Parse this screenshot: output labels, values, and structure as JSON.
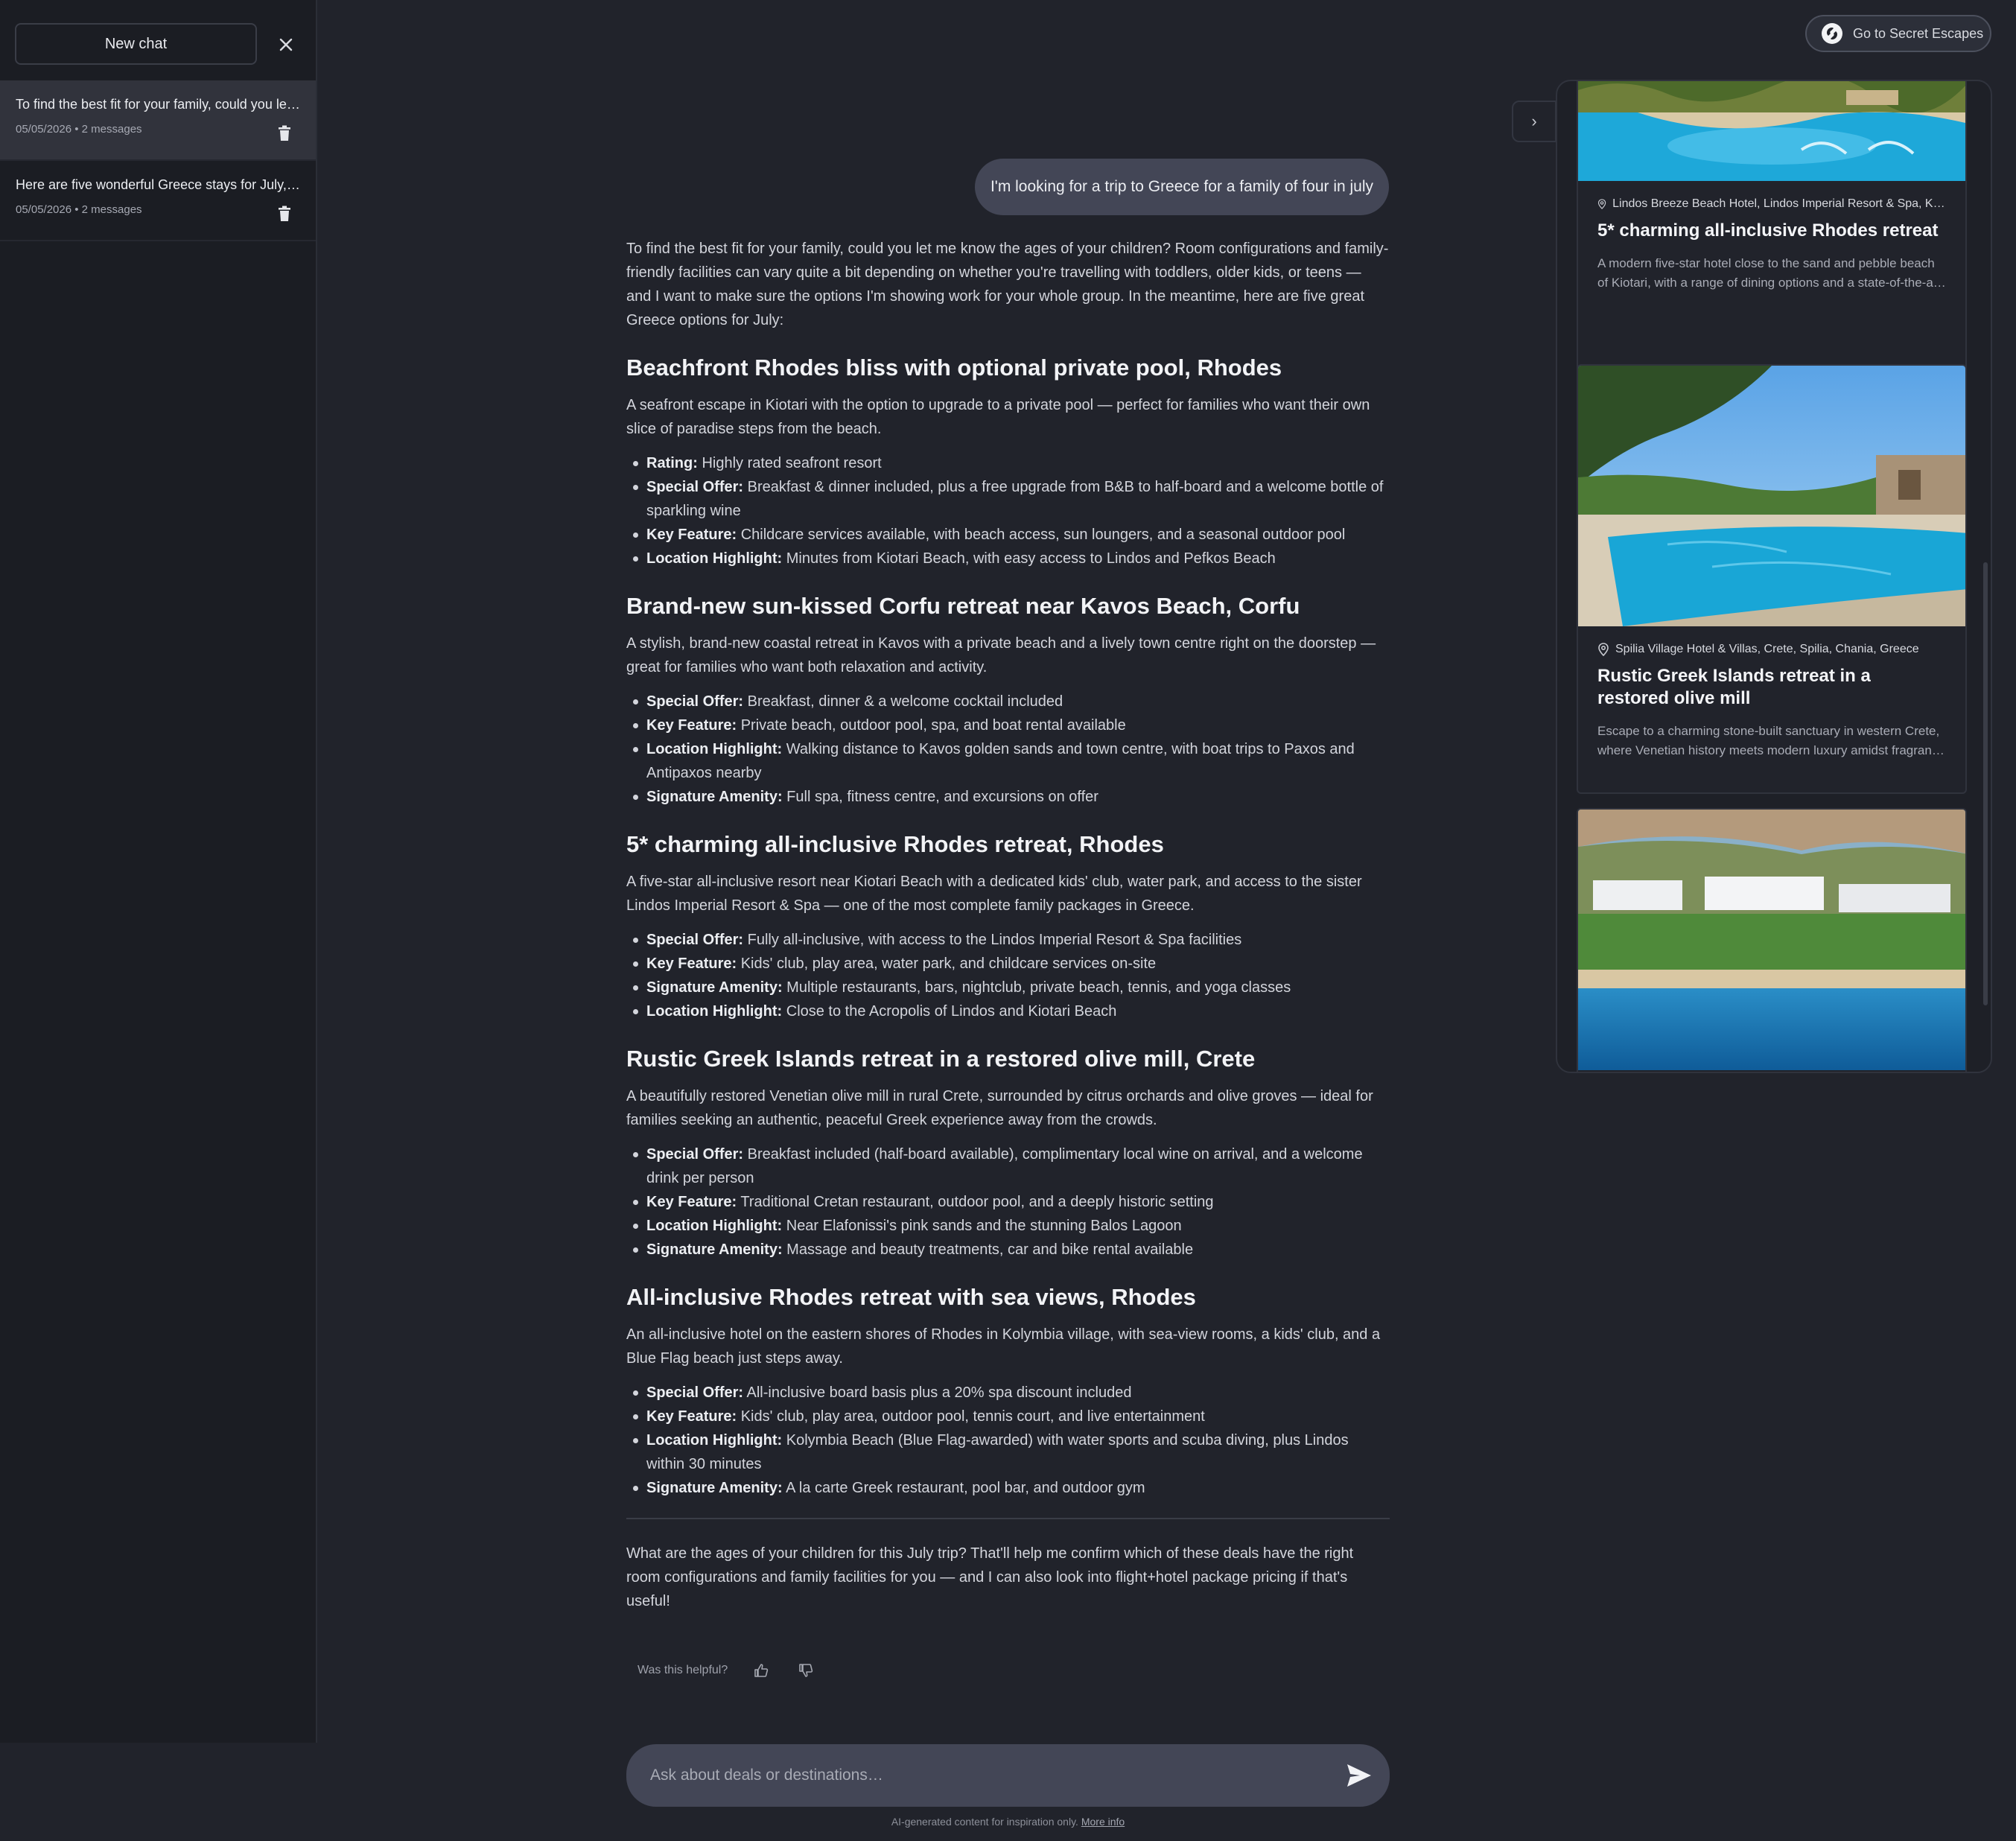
{
  "sidebar": {
    "new_chat_label": "New chat",
    "history": [
      {
        "title": "To find the best fit for your family, could you let me know the ages of your children?",
        "meta": "05/05/2026 • 2 messages"
      },
      {
        "title": "Here are five wonderful Greece stays for July, ready to book",
        "meta": "05/05/2026 • 2 messages"
      }
    ]
  },
  "header": {
    "goto_label": "Go to Secret Escapes"
  },
  "chat": {
    "user_message": "I'm looking for a trip to Greece for a family of four in july",
    "intro": "To find the best fit for your family, could you let me know the ages of your children? Room configurations and family-friendly facilities can vary quite a bit depending on whether you're travelling with toddlers, older kids, or teens — and I want to make sure the options I'm showing work for your whole group. In the meantime, here are five great Greece options for July:",
    "sections": [
      {
        "heading": "Beachfront Rhodes bliss with optional private pool, Rhodes",
        "desc": "A seafront escape in Kiotari with the option to upgrade to a private pool — perfect for families who want their own slice of paradise steps from the beach.",
        "bullets": [
          {
            "label": "Rating:",
            "text": " Highly rated seafront resort"
          },
          {
            "label": "Special Offer:",
            "text": " Breakfast & dinner included, plus a free upgrade from B&B to half-board and a welcome bottle of sparkling wine"
          },
          {
            "label": "Key Feature:",
            "text": " Childcare services available, with beach access, sun loungers, and a seasonal outdoor pool"
          },
          {
            "label": "Location Highlight:",
            "text": " Minutes from Kiotari Beach, with easy access to Lindos and Pefkos Beach"
          }
        ]
      },
      {
        "heading": "Brand-new sun-kissed Corfu retreat near Kavos Beach, Corfu",
        "desc": "A stylish, brand-new coastal retreat in Kavos with a private beach and a lively town centre right on the doorstep — great for families who want both relaxation and activity.",
        "bullets": [
          {
            "label": "Special Offer:",
            "text": " Breakfast, dinner & a welcome cocktail included"
          },
          {
            "label": "Key Feature:",
            "text": " Private beach, outdoor pool, spa, and boat rental available"
          },
          {
            "label": "Location Highlight:",
            "text": " Walking distance to Kavos golden sands and town centre, with boat trips to Paxos and Antipaxos nearby"
          },
          {
            "label": "Signature Amenity:",
            "text": " Full spa, fitness centre, and excursions on offer"
          }
        ]
      },
      {
        "heading": "5* charming all-inclusive Rhodes retreat, Rhodes",
        "desc": "A five-star all-inclusive resort near Kiotari Beach with a dedicated kids' club, water park, and access to the sister Lindos Imperial Resort & Spa — one of the most complete family packages in Greece.",
        "bullets": [
          {
            "label": "Special Offer:",
            "text": " Fully all-inclusive, with access to the Lindos Imperial Resort & Spa facilities"
          },
          {
            "label": "Key Feature:",
            "text": " Kids' club, play area, water park, and childcare services on-site"
          },
          {
            "label": "Signature Amenity:",
            "text": " Multiple restaurants, bars, nightclub, private beach, tennis, and yoga classes"
          },
          {
            "label": "Location Highlight:",
            "text": " Close to the Acropolis of Lindos and Kiotari Beach"
          }
        ]
      },
      {
        "heading": "Rustic Greek Islands retreat in a restored olive mill, Crete",
        "desc": "A beautifully restored Venetian olive mill in rural Crete, surrounded by citrus orchards and olive groves — ideal for families seeking an authentic, peaceful Greek experience away from the crowds.",
        "bullets": [
          {
            "label": "Special Offer:",
            "text": " Breakfast included (half-board available), complimentary local wine on arrival, and a welcome drink per person"
          },
          {
            "label": "Key Feature:",
            "text": " Traditional Cretan restaurant, outdoor pool, and a deeply historic setting"
          },
          {
            "label": "Location Highlight:",
            "text": " Near Elafonissi's pink sands and the stunning Balos Lagoon"
          },
          {
            "label": "Signature Amenity:",
            "text": " Massage and beauty treatments, car and bike rental available"
          }
        ]
      },
      {
        "heading": "All-inclusive Rhodes retreat with sea views, Rhodes",
        "desc": "An all-inclusive hotel on the eastern shores of Rhodes in Kolymbia village, with sea-view rooms, a kids' club, and a Blue Flag beach just steps away.",
        "bullets": [
          {
            "label": "Special Offer:",
            "text": " All-inclusive board basis plus a 20% spa discount included"
          },
          {
            "label": "Key Feature:",
            "text": " Kids' club, play area, outdoor pool, tennis court, and live entertainment"
          },
          {
            "label": "Location Highlight:",
            "text": " Kolymbia Beach (Blue Flag-awarded) with water sports and scuba diving, plus Lindos within 30 minutes"
          },
          {
            "label": "Signature Amenity:",
            "text": " A la carte Greek restaurant, pool bar, and outdoor gym"
          }
        ]
      }
    ],
    "closing": "What are the ages of your children for this July trip? That'll help me confirm which of these deals have the right room configurations and family facilities for you — and I can also look into flight+hotel package pricing if that's useful!",
    "feedback_label": "Was this helpful?"
  },
  "composer": {
    "placeholder": "Ask about deals or destinations…",
    "disclaimer": "AI-generated content for inspiration only.",
    "more_info": "More info"
  },
  "panel": {
    "toggle_glyph": "›",
    "cards": [
      {
        "location": "Lindos Breeze Beach Hotel, Lindos Imperial Resort & Spa, Kiotari, Rhodes, Greece",
        "title": "5* charming all-inclusive Rhodes retreat",
        "desc": "A modern five-star hotel close to the sand and pebble beach of Kiotari, with a range of dining options and a state-of-the-art spa."
      },
      {
        "location": "Spilia Village Hotel & Villas, Crete, Spilia, Chania, Greece",
        "title": "Rustic Greek Islands retreat in a restored olive mill",
        "desc": "Escape to a charming stone-built sanctuary in western Crete, where Venetian history meets modern luxury amidst fragrant olive groves."
      },
      {
        "location": "",
        "title": "",
        "desc": ""
      }
    ]
  }
}
